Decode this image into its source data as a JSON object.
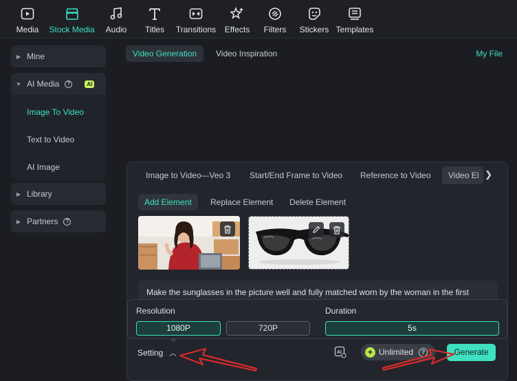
{
  "toolbar": {
    "items": [
      {
        "label": "Media",
        "icon": "media-icon"
      },
      {
        "label": "Stock Media",
        "icon": "stock-media-icon",
        "active": true
      },
      {
        "label": "Audio",
        "icon": "audio-icon"
      },
      {
        "label": "Titles",
        "icon": "titles-icon"
      },
      {
        "label": "Transitions",
        "icon": "transitions-icon"
      },
      {
        "label": "Effects",
        "icon": "effects-icon"
      },
      {
        "label": "Filters",
        "icon": "filters-icon"
      },
      {
        "label": "Stickers",
        "icon": "stickers-icon"
      },
      {
        "label": "Templates",
        "icon": "templates-icon"
      }
    ]
  },
  "sidebar": {
    "mine": "Mine",
    "ai_media": "AI Media",
    "ai_badge": "AI",
    "image_to_video": "Image To Video",
    "text_to_video": "Text to Video",
    "ai_image": "AI Image",
    "library": "Library",
    "partners": "Partners"
  },
  "top_tabs": {
    "video_generation": "Video Generation",
    "video_inspiration": "Video Inspiration",
    "my_file": "My File"
  },
  "card": {
    "tabs": [
      "Image to Video—Veo 3",
      "Start/End Frame to Video",
      "Reference to Video",
      "Video El"
    ],
    "subtabs": [
      "Add Element",
      "Replace Element",
      "Delete Element"
    ],
    "prompt": "Make the sunglasses in the picture well and fully matched worn by the woman in the first video"
  },
  "settings": {
    "resolution_label": "Resolution",
    "res_1080": "1080P",
    "res_720": "720P",
    "duration_label": "Duration",
    "duration_5s": "5s"
  },
  "bottom": {
    "setting": "Setting",
    "unlimited": "Unlimited",
    "generate": "Generate"
  },
  "colors": {
    "accent": "#3ee0c1",
    "annotation_arrow": "#d62b2b"
  }
}
